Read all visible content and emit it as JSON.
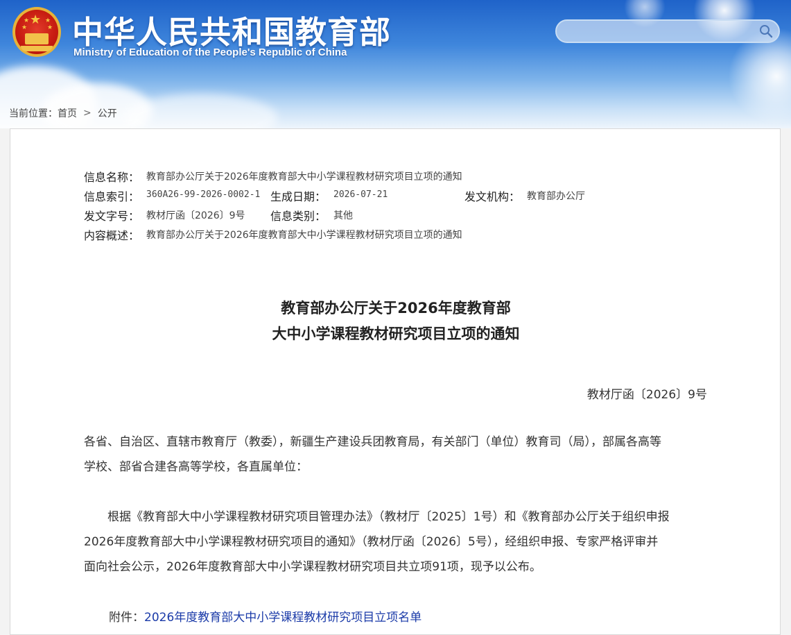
{
  "header": {
    "title": "中华人民共和国教育部",
    "subtitle": "Ministry of Education of the People's Republic of China",
    "search": {
      "placeholder": ""
    }
  },
  "breadcrumb": {
    "label": "当前位置：",
    "items": [
      "首页",
      "公开"
    ],
    "separator": ">"
  },
  "meta": {
    "name_label": "信息名称：",
    "name_value": "教育部办公厅关于2026年度教育部大中小学课程教材研究项目立项的通知",
    "index_label": "信息索引：",
    "index_value": "360A26-99-2026-0002-1",
    "date_label": "生成日期：",
    "date_value": "2026-07-21",
    "issuer_label": "发文机构：",
    "issuer_value": "教育部办公厅",
    "docno_label": "发文字号：",
    "docno_value": "教材厅函〔2026〕9号",
    "category_label": "信息类别：",
    "category_value": "其他",
    "summary_label": "内容概述：",
    "summary_value": "教育部办公厅关于2026年度教育部大中小学课程教材研究项目立项的通知"
  },
  "document": {
    "title_line1": "教育部办公厅关于2026年度教育部",
    "title_line2": "大中小学课程教材研究项目立项的通知",
    "number": "教材厅函〔2026〕9号",
    "recipients": [
      "各省、自治区、直辖市教育厅（教委），新疆生产建设兵团教育局，有关部门（单位）教育司（局），部属各高等",
      "学校、部省合建各高等学校，各直属单位："
    ],
    "body": [
      "　　根据《教育部大中小学课程教材研究项目管理办法》（教材厅〔2025〕1号）和《教育部办公厅关于组织申报",
      "2026年度教育部大中小学课程教材研究项目的通知》（教材厅函〔2026〕5号），经组织申报、专家严格评审并",
      "面向社会公示，2026年度教育部大中小学课程教材研究项目共立项91项，现予以公布。"
    ],
    "attachment_label": "附件：",
    "attachment_link": "2026年度教育部大中小学课程教材研究项目立项名单"
  },
  "colors": {
    "header_blue": "#1f63c9",
    "link": "#1a3aa8",
    "emblem_red": "#c81d12",
    "emblem_gold": "#f2c24a"
  },
  "icons": [
    "national-emblem-icon",
    "search-icon",
    "chevron-right-icon"
  ]
}
